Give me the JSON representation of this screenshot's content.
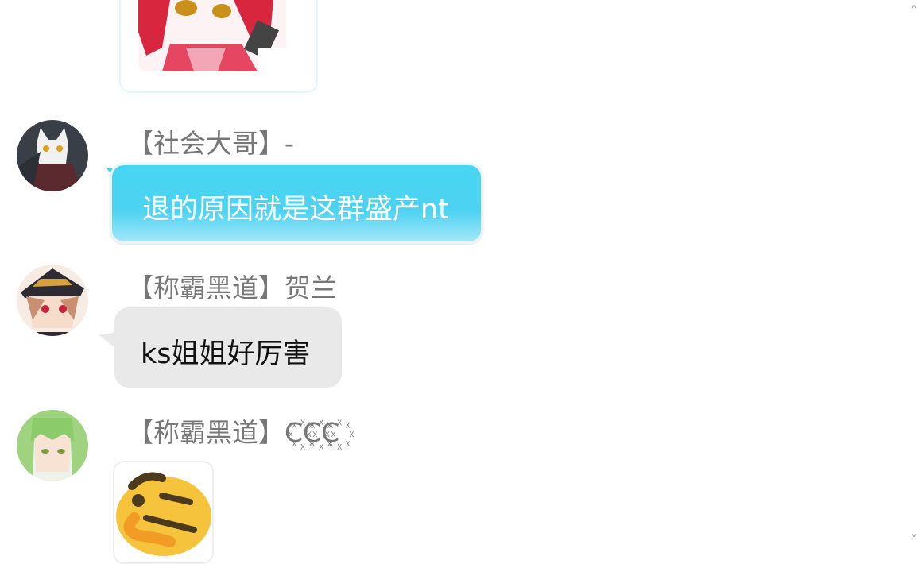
{
  "messages": [
    {
      "sender": "【社会大哥】-",
      "text": "退的原因就是这群盛产nt",
      "bubble_color": "#4dd2f1"
    },
    {
      "sender": "【称霸黑道】贺兰",
      "text": "ks姐姐好厉害",
      "bubble_color": "#e9e9e9"
    },
    {
      "sender": "【称霸黑道】C꙰C꙰C꙰",
      "text": "",
      "sticker": "thinking-face-sticker"
    }
  ],
  "scroll": {
    "top_glyph": "˄",
    "bottom_glyph": "˅"
  }
}
